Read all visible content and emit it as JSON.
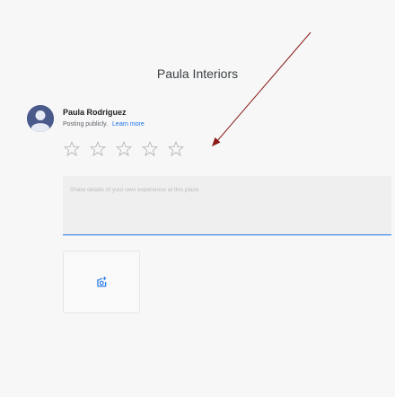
{
  "place": {
    "title": "Paula Interiors"
  },
  "user": {
    "name": "Paula Rodriguez",
    "posting_text": "Posting publicly.",
    "learn_more": "Learn more"
  },
  "rating": {
    "max_stars": 5,
    "selected_stars": 0
  },
  "review": {
    "value": "",
    "placeholder": "Share details of your own experience at this place"
  },
  "photo_button": {
    "icon": "add-photo-icon"
  },
  "annotation": {
    "arrow_color": "#8b1a1a"
  },
  "colors": {
    "accent": "#1a73e8",
    "avatar": "#4a5a8a"
  }
}
